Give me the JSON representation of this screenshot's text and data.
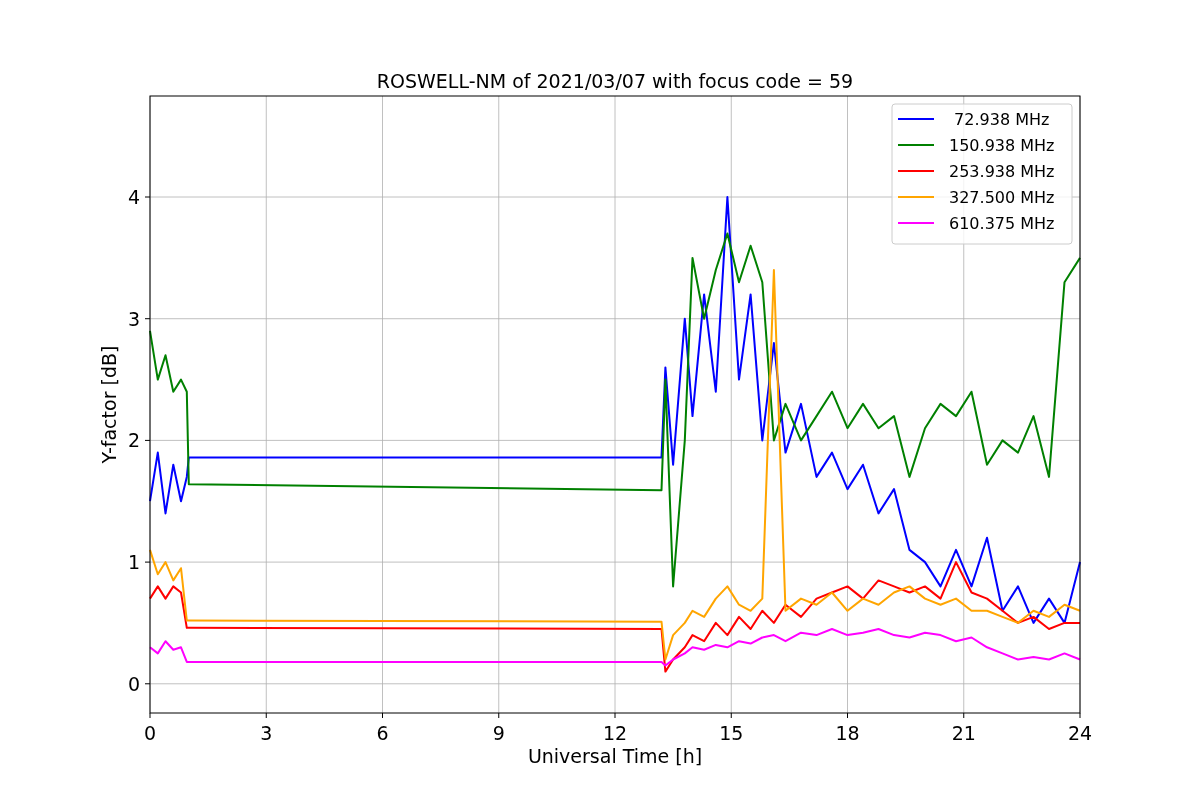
{
  "figure": {
    "chart_data": {
      "type": "line",
      "title": "ROSWELL-NM of 2021/03/07 with focus code = 59",
      "xlabel": "Universal Time [h]",
      "ylabel": "Y-factor [dB]",
      "x": [
        0,
        0.2,
        0.4,
        0.6,
        0.8,
        0.95,
        1.0,
        13.2,
        13.3,
        13.5,
        13.8,
        14,
        14.3,
        14.6,
        14.9,
        15.2,
        15.5,
        15.8,
        16.1,
        16.4,
        16.8,
        17.2,
        17.6,
        18,
        18.4,
        18.8,
        19.2,
        19.6,
        20,
        20.4,
        20.8,
        21.2,
        21.6,
        22,
        22.4,
        22.8,
        23.2,
        23.6,
        24
      ],
      "grid": true,
      "legend": true,
      "xlim": [
        0,
        24
      ],
      "ylim": [
        -0.24,
        4.83
      ],
      "xticks": [
        0,
        3,
        6,
        9,
        12,
        15,
        18,
        21,
        24
      ],
      "yticks": [
        0,
        1,
        2,
        3,
        4
      ],
      "series": [
        {
          "name": " 72.938 MHz",
          "color": "#0000ff",
          "values": [
            1.5,
            1.9,
            1.4,
            1.8,
            1.5,
            1.7,
            1.86,
            1.86,
            2.6,
            1.8,
            3.0,
            2.2,
            3.2,
            2.4,
            4.0,
            2.5,
            3.2,
            2.0,
            2.8,
            1.9,
            2.3,
            1.7,
            1.9,
            1.6,
            1.8,
            1.4,
            1.6,
            1.1,
            1.0,
            0.8,
            1.1,
            0.8,
            1.2,
            0.6,
            0.8,
            0.5,
            0.7,
            0.5,
            1.0
          ]
        },
        {
          "name": "150.938 MHz",
          "color": "#008000",
          "values": [
            2.9,
            2.5,
            2.7,
            2.4,
            2.5,
            2.4,
            1.64,
            1.59,
            2.5,
            0.8,
            2.0,
            3.5,
            3.0,
            3.4,
            3.7,
            3.3,
            3.6,
            3.3,
            2.0,
            2.3,
            2.0,
            2.2,
            2.4,
            2.1,
            2.3,
            2.1,
            2.2,
            1.7,
            2.1,
            2.3,
            2.2,
            2.4,
            1.8,
            2.0,
            1.9,
            2.2,
            1.7,
            3.3,
            3.5
          ]
        },
        {
          "name": "253.938 MHz",
          "color": "#ff0000",
          "values": [
            0.7,
            0.8,
            0.7,
            0.8,
            0.75,
            0.46,
            0.46,
            0.45,
            0.1,
            0.2,
            0.3,
            0.4,
            0.35,
            0.5,
            0.4,
            0.55,
            0.45,
            0.6,
            0.5,
            0.65,
            0.55,
            0.7,
            0.75,
            0.8,
            0.7,
            0.85,
            0.8,
            0.75,
            0.8,
            0.7,
            1.0,
            0.75,
            0.7,
            0.6,
            0.5,
            0.55,
            0.45,
            0.5,
            0.5
          ]
        },
        {
          "name": "327.500 MHz",
          "color": "#ffa500",
          "values": [
            1.1,
            0.9,
            1.0,
            0.85,
            0.95,
            0.52,
            0.52,
            0.51,
            0.2,
            0.4,
            0.5,
            0.6,
            0.55,
            0.7,
            0.8,
            0.65,
            0.6,
            0.7,
            3.4,
            0.6,
            0.7,
            0.65,
            0.75,
            0.6,
            0.7,
            0.65,
            0.75,
            0.8,
            0.7,
            0.65,
            0.7,
            0.6,
            0.6,
            0.55,
            0.5,
            0.6,
            0.55,
            0.65,
            0.6
          ]
        },
        {
          "name": "610.375 MHz",
          "color": "#ff00ff",
          "values": [
            0.3,
            0.25,
            0.35,
            0.28,
            0.3,
            0.18,
            0.18,
            0.18,
            0.15,
            0.2,
            0.25,
            0.3,
            0.28,
            0.32,
            0.3,
            0.35,
            0.33,
            0.38,
            0.4,
            0.35,
            0.42,
            0.4,
            0.45,
            0.4,
            0.42,
            0.45,
            0.4,
            0.38,
            0.42,
            0.4,
            0.35,
            0.38,
            0.3,
            0.25,
            0.2,
            0.22,
            0.2,
            0.25,
            0.2
          ]
        }
      ]
    }
  }
}
